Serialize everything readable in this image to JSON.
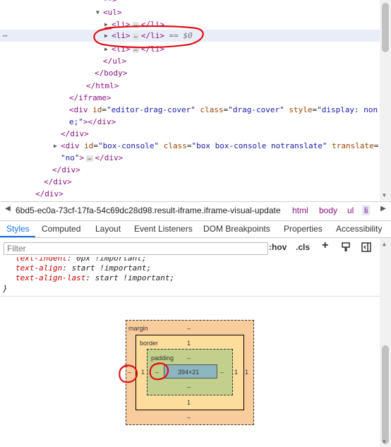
{
  "tree": {
    "lines": {
      "l0": "-->",
      "l1_tag": "<ul>",
      "l2_open": "<li>",
      "l2_ell": "…",
      "l2_close": "</li>",
      "l3_open": "<li>",
      "l3_ell": "…",
      "l3_close": "</li>",
      "l3_eq": "== $0",
      "l4_open": "<li>",
      "l4_ell": "…",
      "l4_close": "</li>",
      "l5": "</ul>",
      "l6": "</body>",
      "l7": "</html>",
      "l8": "</iframe>",
      "l9_div": "<div",
      "l9_id_n": "id",
      "l9_id_v": "\"editor-drag-cover\"",
      "l9_class_n": "class",
      "l9_class_v": "\"drag-cover\"",
      "l9_style_n": "style",
      "l9_style_v": "\"display: non",
      "l10_v": "e;\"",
      "l10_gt": ">",
      "l10_close": "</div>",
      "l11": "</div>",
      "l12_div": "<div",
      "l12_id_n": "id",
      "l12_id_v": "\"box-console\"",
      "l12_class_n": "class",
      "l12_class_v": "\"box box-console notranslate\"",
      "l12_tr_n": "translate",
      "l12_tr_eq": "=",
      "l13_v": "\"no\"",
      "l13_gt": ">",
      "l13_ell": "…",
      "l13_close": "</div>",
      "l14": "</div>",
      "l15": "</div>",
      "l16": "</div>"
    },
    "row_menu": "⋯"
  },
  "breadcrumb": {
    "path": "6bd5-ec0a-73cf-17fa-54c69dc28d98.result-iframe.iframe-visual-update",
    "items": [
      "html",
      "body",
      "ul",
      "li"
    ],
    "prev": "◀",
    "next": "▶"
  },
  "tabs": [
    "Styles",
    "Computed",
    "Layout",
    "Event Listeners",
    "DOM Breakpoints",
    "Properties",
    "Accessibility"
  ],
  "filter": {
    "placeholder": "Filter",
    "hov": ":hov",
    "cls": ".cls",
    "plus": "+"
  },
  "rules": [
    {
      "prop": "text-indent",
      "val": "0px !important;"
    },
    {
      "prop": "text-align",
      "val": "start !important;"
    },
    {
      "prop": "text-align-last",
      "val": "start !important;"
    }
  ],
  "rule_close": "}",
  "box_model": {
    "margin_label": "margin",
    "margin_top": "–",
    "margin_bottom": "–",
    "margin_left": "–",
    "margin_right": "1",
    "border_label": "border",
    "border_top": "1",
    "border_bottom": "1",
    "border_left": "1",
    "border_right": "–",
    "padding_label": "padding",
    "padding_top": "–",
    "padding_bottom": "–",
    "padding_left": "–",
    "padding_right": "–",
    "content": "394×21",
    "extra_right": "1"
  },
  "colors": {
    "annotation": "#e0101a",
    "margin": "#f9cc9d",
    "border": "#fddd9b",
    "padding": "#c3d08b",
    "content": "#8cb6c0",
    "active_tab": "#1a73e8"
  }
}
